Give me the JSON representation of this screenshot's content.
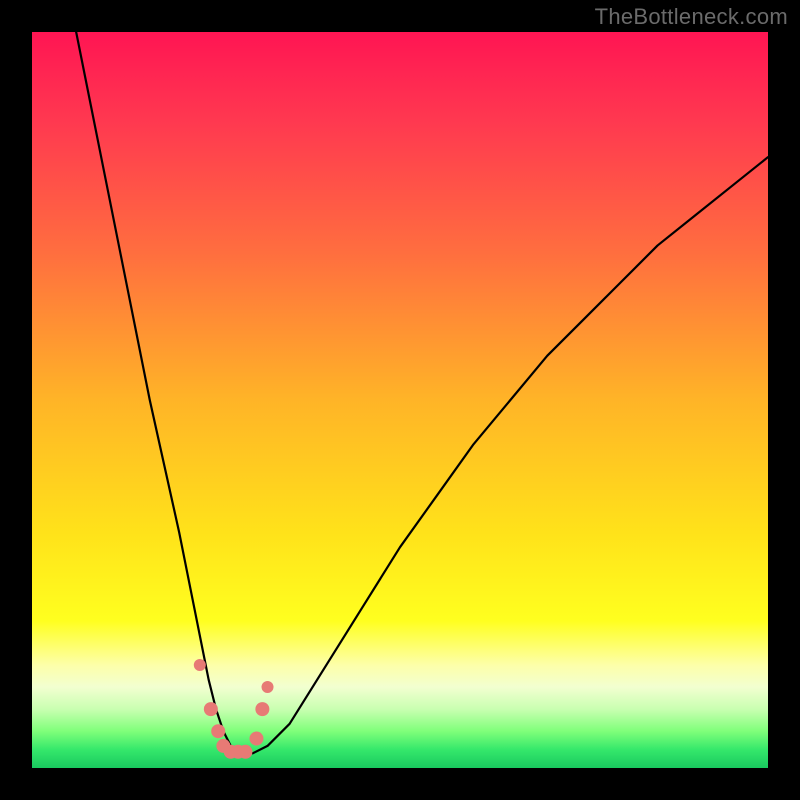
{
  "watermark": "TheBottleneck.com",
  "chart_data": {
    "type": "line",
    "title": "",
    "xlabel": "",
    "ylabel": "",
    "xlim": [
      0,
      100
    ],
    "ylim": [
      0,
      100
    ],
    "series": [
      {
        "name": "curve",
        "x": [
          6,
          8,
          10,
          12,
          14,
          16,
          18,
          20,
          22,
          23,
          24,
          25,
          26,
          27,
          28,
          29,
          30,
          32,
          35,
          40,
          45,
          50,
          55,
          60,
          65,
          70,
          75,
          80,
          85,
          90,
          95,
          100
        ],
        "y": [
          100,
          90,
          80,
          70,
          60,
          50,
          41,
          32,
          22,
          17,
          12,
          8,
          5,
          3,
          2,
          2,
          2,
          3,
          6,
          14,
          22,
          30,
          37,
          44,
          50,
          56,
          61,
          66,
          71,
          75,
          79,
          83
        ]
      }
    ],
    "markers": {
      "name": "highlight-points",
      "x": [
        22.8,
        24.3,
        25.3,
        26.0,
        27.0,
        28.0,
        29.0,
        30.5,
        31.3,
        32.0
      ],
      "y": [
        14.0,
        8.0,
        5.0,
        3.0,
        2.2,
        2.2,
        2.2,
        4.0,
        8.0,
        11.0
      ],
      "color": "#e77a75"
    },
    "gradient_stops": [
      {
        "offset": 0.0,
        "color": "#ff1553"
      },
      {
        "offset": 0.12,
        "color": "#ff3850"
      },
      {
        "offset": 0.3,
        "color": "#ff6e3f"
      },
      {
        "offset": 0.5,
        "color": "#ffb427"
      },
      {
        "offset": 0.68,
        "color": "#ffe21a"
      },
      {
        "offset": 0.8,
        "color": "#ffff1f"
      },
      {
        "offset": 0.86,
        "color": "#fdffa9"
      },
      {
        "offset": 0.89,
        "color": "#f2ffd0"
      },
      {
        "offset": 0.92,
        "color": "#c9ffb1"
      },
      {
        "offset": 0.95,
        "color": "#7fff7a"
      },
      {
        "offset": 0.975,
        "color": "#35e86b"
      },
      {
        "offset": 1.0,
        "color": "#19c95f"
      }
    ]
  }
}
